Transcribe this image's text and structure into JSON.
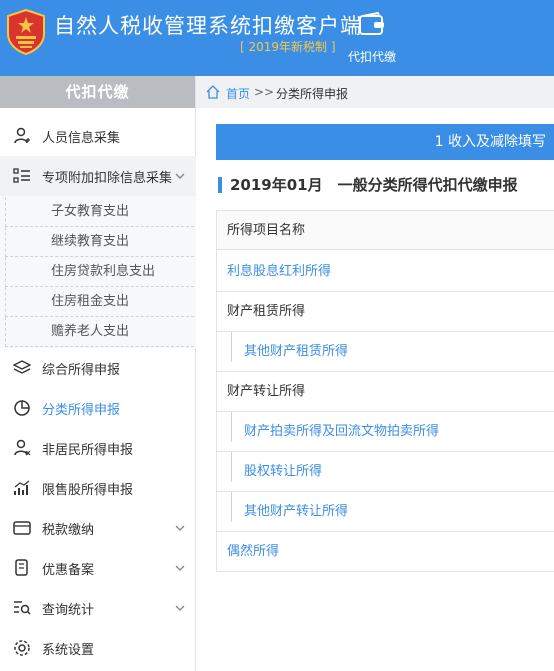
{
  "header": {
    "title": "自然人税收管理系统扣缴客户端",
    "subtitle": "[ 2019年新税制 ]",
    "tab_label": "代扣代缴",
    "bg_color": "#3b8ee6",
    "subtitle_color": "#f7c748"
  },
  "sidebar": {
    "heading": "代扣代缴",
    "items": [
      {
        "label": "人员信息采集",
        "icon": "person-icon"
      },
      {
        "label": "专项附加扣除信息采集",
        "icon": "list-icon"
      },
      {
        "label": "综合所得申报",
        "icon": "layers-icon"
      },
      {
        "label": "分类所得申报",
        "icon": "pie-icon"
      },
      {
        "label": "非居民所得申报",
        "icon": "foreign-person-icon"
      },
      {
        "label": "限售股所得申报",
        "icon": "bar-chart-icon"
      },
      {
        "label": "税款缴纳",
        "icon": "wallet-icon"
      },
      {
        "label": "优惠备案",
        "icon": "document-icon"
      },
      {
        "label": "查询统计",
        "icon": "search-list-icon"
      },
      {
        "label": "系统设置",
        "icon": "gear-icon"
      }
    ],
    "subitems": [
      "子女教育支出",
      "继续教育支出",
      "住房贷款利息支出",
      "住房租金支出",
      "赡养老人支出"
    ]
  },
  "breadcrumb": {
    "home": "首页",
    "separator": ">>",
    "current": "分类所得申报"
  },
  "main": {
    "step": "1 收入及减除填写",
    "section_title": "2019年01月　一般分类所得代扣代缴申报",
    "table": {
      "header": "所得项目名称",
      "rows": [
        {
          "label": "利息股息红利所得",
          "level": 1,
          "link": true
        },
        {
          "label": "财产租赁所得",
          "level": 1,
          "link": false
        },
        {
          "label": "其他财产租赁所得",
          "level": 2,
          "link": true
        },
        {
          "label": "财产转让所得",
          "level": 1,
          "link": false
        },
        {
          "label": "财产拍卖所得及回流文物拍卖所得",
          "level": 2,
          "link": true
        },
        {
          "label": "股权转让所得",
          "level": 2,
          "link": true
        },
        {
          "label": "其他财产转让所得",
          "level": 2,
          "link": true
        },
        {
          "label": "偶然所得",
          "level": 1,
          "link": true
        }
      ]
    }
  }
}
